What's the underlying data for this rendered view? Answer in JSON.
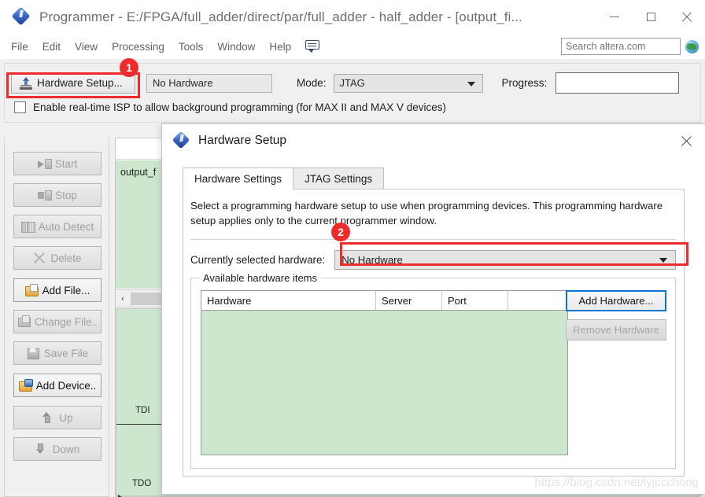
{
  "window": {
    "title": "Programmer - E:/FPGA/full_adder/direct/par/full_adder - half_adder - [output_fi...",
    "app_icon": "quartus-diamond-icon",
    "minimize_label": "—",
    "maximize_label": "□",
    "close_label": "✕"
  },
  "menubar": {
    "items": [
      {
        "label": "File"
      },
      {
        "label": "Edit"
      },
      {
        "label": "View"
      },
      {
        "label": "Processing"
      },
      {
        "label": "Tools"
      },
      {
        "label": "Window"
      },
      {
        "label": "Help"
      }
    ],
    "bubble_icon": "speech-bubble-icon"
  },
  "search": {
    "placeholder": "Search altera.com",
    "value": "",
    "globe_icon": "globe-icon"
  },
  "toolbar": {
    "hardware_setup_button": "Hardware Setup...",
    "hardware_setup_icon": "hardware-chip-icon",
    "hardware_value": "No Hardware",
    "mode_label": "Mode:",
    "mode_value": "JTAG",
    "progress_label": "Progress:",
    "progress_value": "",
    "realtime_isp_label": "Enable real-time ISP to allow background programming (for MAX II and MAX V devices)",
    "realtime_isp_checked": false
  },
  "sidebar": {
    "buttons": [
      {
        "label": "Start",
        "icon": "start-icon",
        "enabled": false
      },
      {
        "label": "Stop",
        "icon": "stop-icon",
        "enabled": false
      },
      {
        "label": "Auto Detect",
        "icon": "auto-detect-icon",
        "enabled": false
      },
      {
        "label": "Delete",
        "icon": "delete-icon",
        "enabled": false
      },
      {
        "label": "Add File...",
        "icon": "add-file-icon",
        "enabled": true
      },
      {
        "label": "Change File..",
        "icon": "change-file-icon",
        "enabled": false
      },
      {
        "label": "Save File",
        "icon": "save-file-icon",
        "enabled": false
      },
      {
        "label": "Add Device..",
        "icon": "add-device-icon",
        "enabled": true
      },
      {
        "label": "Up",
        "icon": "arrow-up-icon",
        "enabled": false
      },
      {
        "label": "Down",
        "icon": "arrow-down-icon",
        "enabled": false
      }
    ]
  },
  "chain_view": {
    "file_label": "output_f",
    "tdi_label": "TDI",
    "tdo_label": "TDO",
    "scroll_left_arrow": "‹"
  },
  "dialog": {
    "title": "Hardware Setup",
    "icon": "quartus-diamond-icon",
    "close_label": "✕",
    "tabs": [
      {
        "label": "Hardware Settings",
        "active": true
      },
      {
        "label": "JTAG Settings",
        "active": false
      }
    ],
    "description": "Select a programming hardware setup to use when programming devices. This programming hardware setup applies only to the current programmer window.",
    "current_hardware_label": "Currently selected hardware:",
    "current_hardware_value": "No Hardware",
    "group_title": "Available hardware items",
    "table": {
      "columns": [
        "Hardware",
        "Server",
        "Port",
        ""
      ],
      "rows": []
    },
    "add_hardware_button": "Add Hardware...",
    "remove_hardware_button": "Remove Hardware"
  },
  "annotations": [
    {
      "number": "1",
      "target": "hardware-setup-button"
    },
    {
      "number": "2",
      "target": "currently-selected-hardware-dropdown"
    }
  ],
  "watermark": "https://blog.csdn.net/lyjccchong",
  "colors": {
    "annotation_red": "#f02b2b",
    "table_green": "#cde7ce",
    "accent_blue": "#0a74d6",
    "title_grey": "#6b7076"
  }
}
